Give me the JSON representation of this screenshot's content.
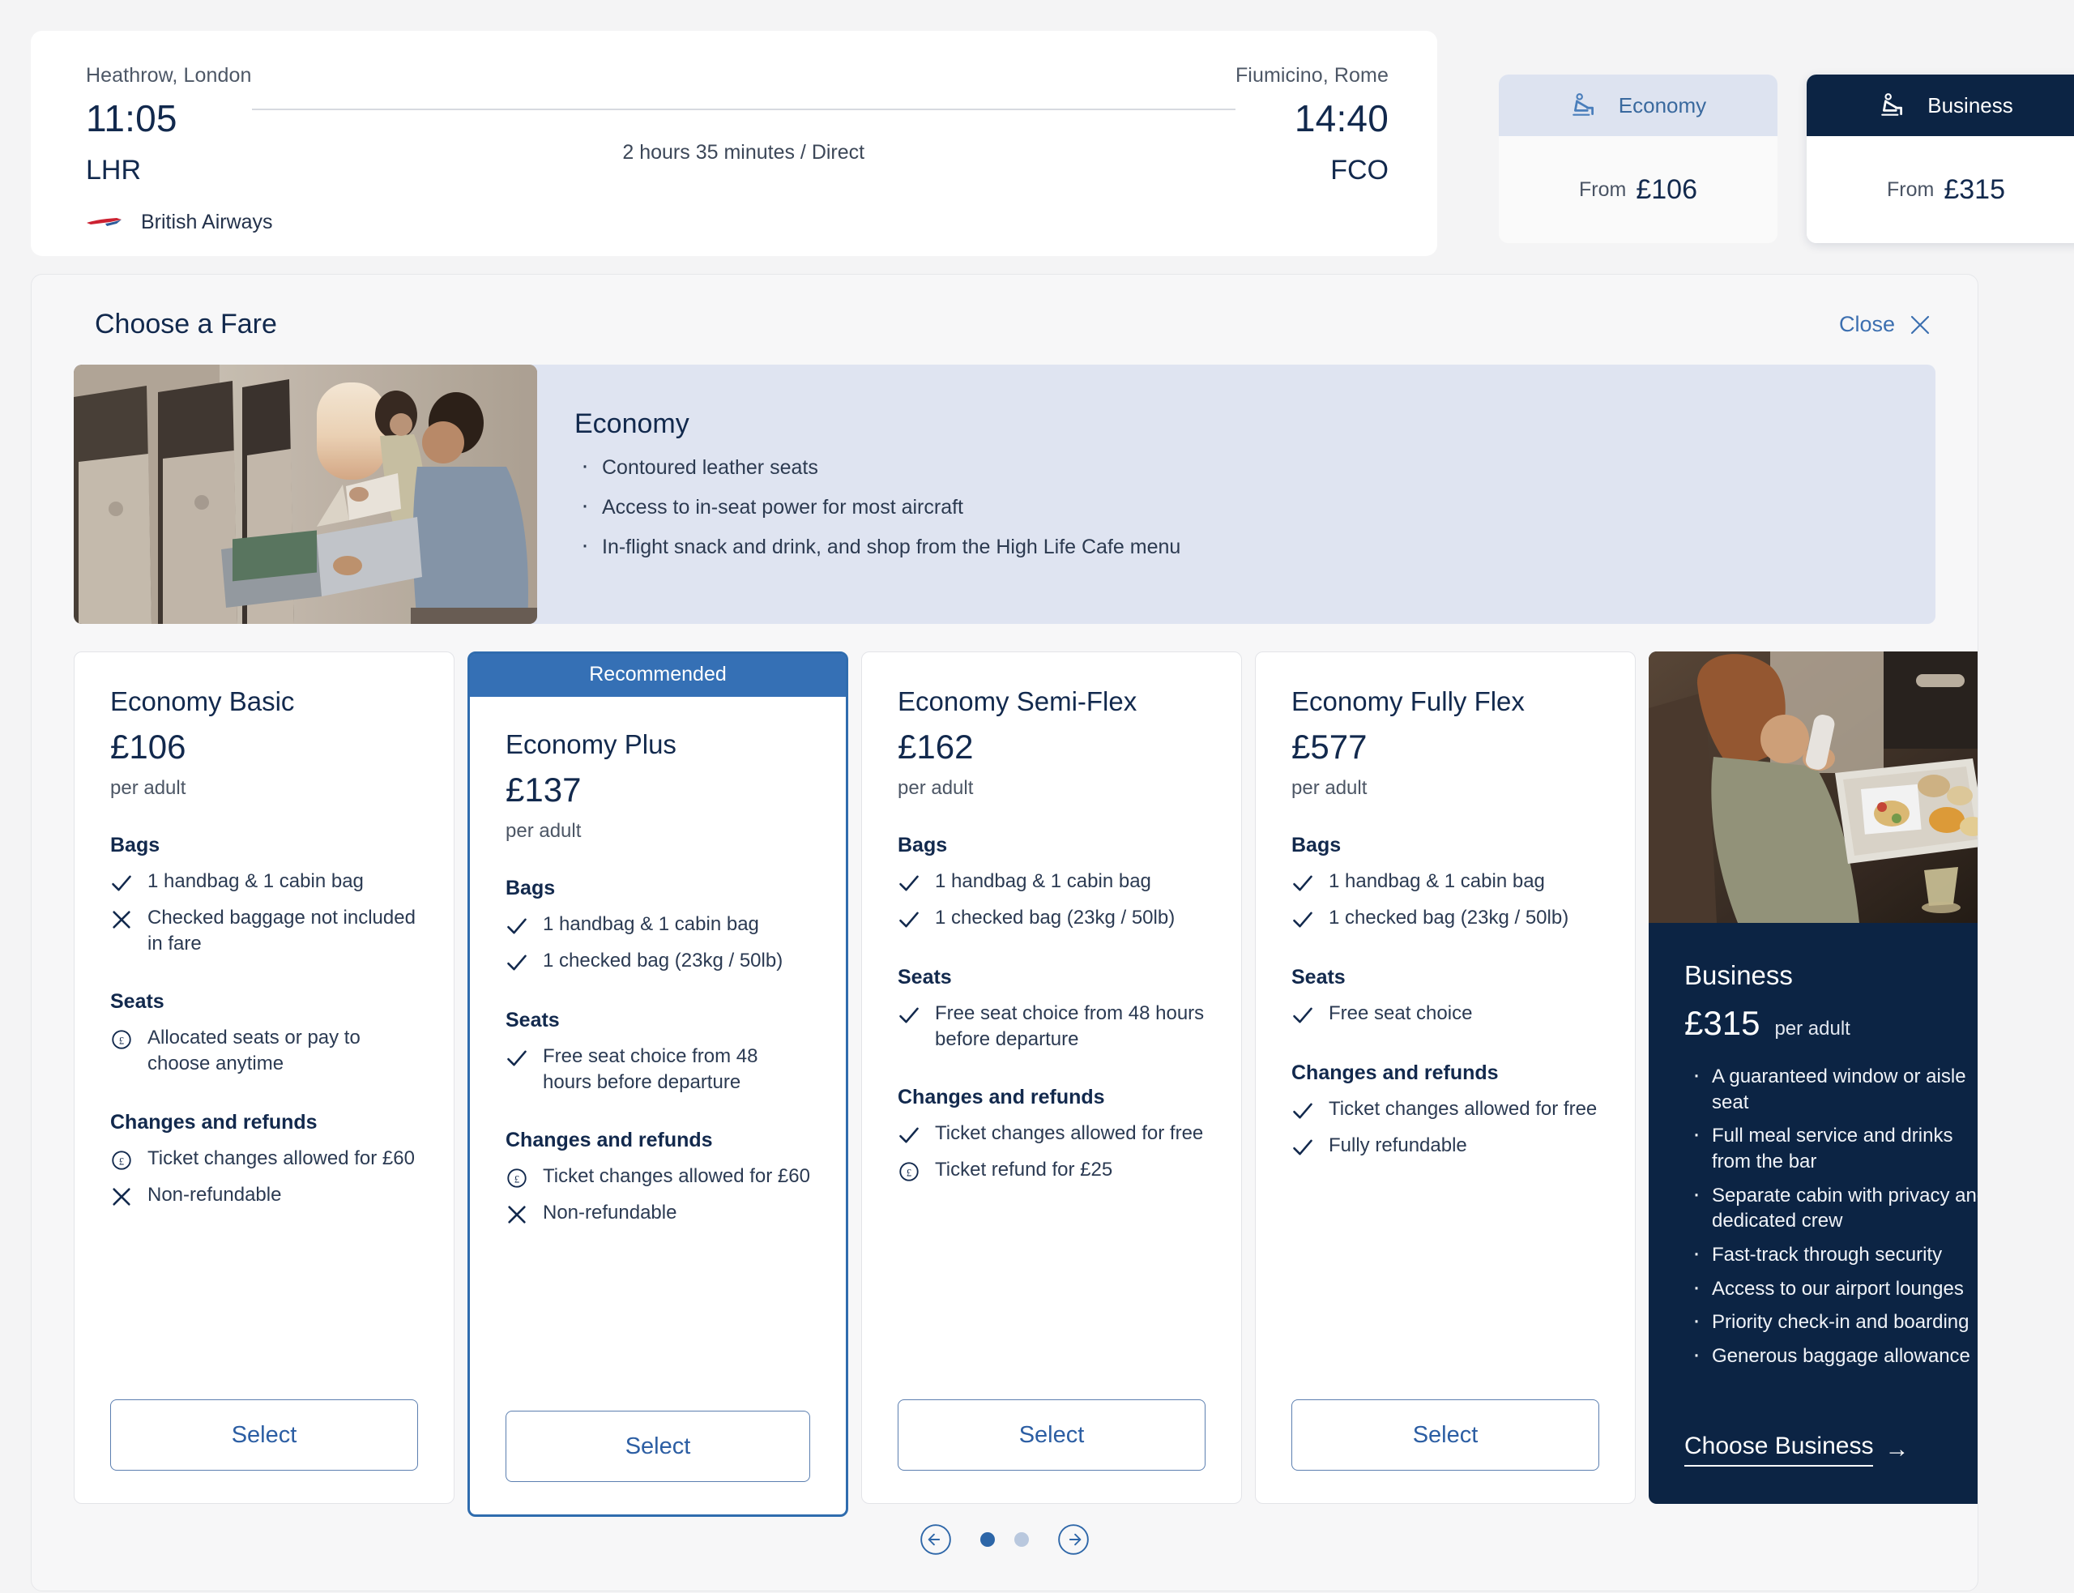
{
  "flight": {
    "origin_city": "Heathrow, London",
    "origin_time": "11:05",
    "origin_code": "LHR",
    "destination_city": "Fiumicino, Rome",
    "destination_time": "14:40",
    "destination_code": "FCO",
    "duration": "2 hours 35 minutes / Direct",
    "airline": "British Airways",
    "airline_logo_icon": "british-airways-speedmarque-icon"
  },
  "cabin_tabs": [
    {
      "label": "Economy",
      "icon": "reclined-seat-icon",
      "from_label": "From",
      "price": "£106",
      "selected": true
    },
    {
      "label": "Business",
      "icon": "reclined-seat-icon",
      "from_label": "From",
      "price": "£315",
      "selected": false
    }
  ],
  "fare_panel": {
    "title": "Choose a Fare",
    "close_label": "Close",
    "close_icon": "close-x-icon",
    "hero": {
      "photo_icon": "economy-cabin-photo",
      "title": "Economy",
      "bullets": [
        "Contoured leather seats",
        "Access to in-seat power for most aircraft",
        "In-flight snack and drink, and shop from the High Life Cafe menu"
      ]
    },
    "cards": [
      {
        "name": "Economy Basic",
        "price": "£106",
        "per": "per adult",
        "recommended": false,
        "sections": [
          {
            "title": "Bags",
            "items": [
              {
                "icon": "check-icon",
                "text": "1 handbag & 1 cabin bag"
              },
              {
                "icon": "cross-icon",
                "text": "Checked baggage not included in fare"
              }
            ]
          },
          {
            "title": "Seats",
            "items": [
              {
                "icon": "pound-circle-icon",
                "text": "Allocated seats or pay to choose anytime"
              }
            ]
          },
          {
            "title": "Changes and refunds",
            "items": [
              {
                "icon": "pound-circle-icon",
                "text": "Ticket changes allowed for £60"
              },
              {
                "icon": "cross-icon",
                "text": "Non-refundable"
              }
            ]
          }
        ],
        "select_label": "Select"
      },
      {
        "name": "Economy Plus",
        "price": "£137",
        "per": "per adult",
        "recommended": true,
        "recommended_label": "Recommended",
        "sections": [
          {
            "title": "Bags",
            "items": [
              {
                "icon": "check-icon",
                "text": "1 handbag & 1 cabin bag"
              },
              {
                "icon": "check-icon",
                "text": "1 checked bag (23kg / 50lb)"
              }
            ]
          },
          {
            "title": "Seats",
            "items": [
              {
                "icon": "check-icon",
                "text": "Free seat choice from 48 hours before departure"
              }
            ]
          },
          {
            "title": "Changes and refunds",
            "items": [
              {
                "icon": "pound-circle-icon",
                "text": "Ticket changes allowed for £60"
              },
              {
                "icon": "cross-icon",
                "text": "Non-refundable"
              }
            ]
          }
        ],
        "select_label": "Select"
      },
      {
        "name": "Economy Semi-Flex",
        "price": "£162",
        "per": "per adult",
        "recommended": false,
        "sections": [
          {
            "title": "Bags",
            "items": [
              {
                "icon": "check-icon",
                "text": "1 handbag & 1 cabin bag"
              },
              {
                "icon": "check-icon",
                "text": "1 checked bag (23kg / 50lb)"
              }
            ]
          },
          {
            "title": "Seats",
            "items": [
              {
                "icon": "check-icon",
                "text": "Free seat choice from 48 hours before departure"
              }
            ]
          },
          {
            "title": "Changes and refunds",
            "items": [
              {
                "icon": "check-icon",
                "text": "Ticket changes allowed for free"
              },
              {
                "icon": "pound-circle-icon",
                "text": "Ticket refund for £25"
              }
            ]
          }
        ],
        "select_label": "Select"
      },
      {
        "name": "Economy Fully Flex",
        "price": "£577",
        "per": "per adult",
        "recommended": false,
        "sections": [
          {
            "title": "Bags",
            "items": [
              {
                "icon": "check-icon",
                "text": "1 handbag & 1 cabin bag"
              },
              {
                "icon": "check-icon",
                "text": "1 checked bag (23kg / 50lb)"
              }
            ]
          },
          {
            "title": "Seats",
            "items": [
              {
                "icon": "check-icon",
                "text": "Free seat choice"
              }
            ]
          },
          {
            "title": "Changes and refunds",
            "items": [
              {
                "icon": "check-icon",
                "text": "Ticket changes allowed for free"
              },
              {
                "icon": "check-icon",
                "text": "Fully refundable"
              }
            ]
          }
        ],
        "select_label": "Select"
      }
    ],
    "business_promo": {
      "photo_icon": "business-meal-photo",
      "title": "Business",
      "price": "£315",
      "per": "per adult",
      "bullets": [
        "A guaranteed window or aisle seat",
        "Full meal service and drinks from the bar",
        "Separate cabin with privacy and dedicated crew",
        "Fast-track through security",
        "Access to our airport lounges",
        "Priority check-in and boarding",
        "Generous baggage allowance"
      ],
      "cta_label": "Choose Business",
      "cta_arrow": "→"
    },
    "pager": {
      "prev_icon": "arrow-left-circle-icon",
      "next_icon": "arrow-right-circle-icon",
      "dots": 2,
      "active_dot": 0
    }
  },
  "colors": {
    "navy": "#0c2444",
    "text_navy": "#12294d",
    "accent_blue": "#3570b5",
    "link_blue": "#3c6fb0",
    "hero_bg": "#dfe4f1",
    "tab_economy_bg": "#dde3f0",
    "page_bg": "#f4f4f5",
    "panel_bg": "#f7f7f8"
  }
}
